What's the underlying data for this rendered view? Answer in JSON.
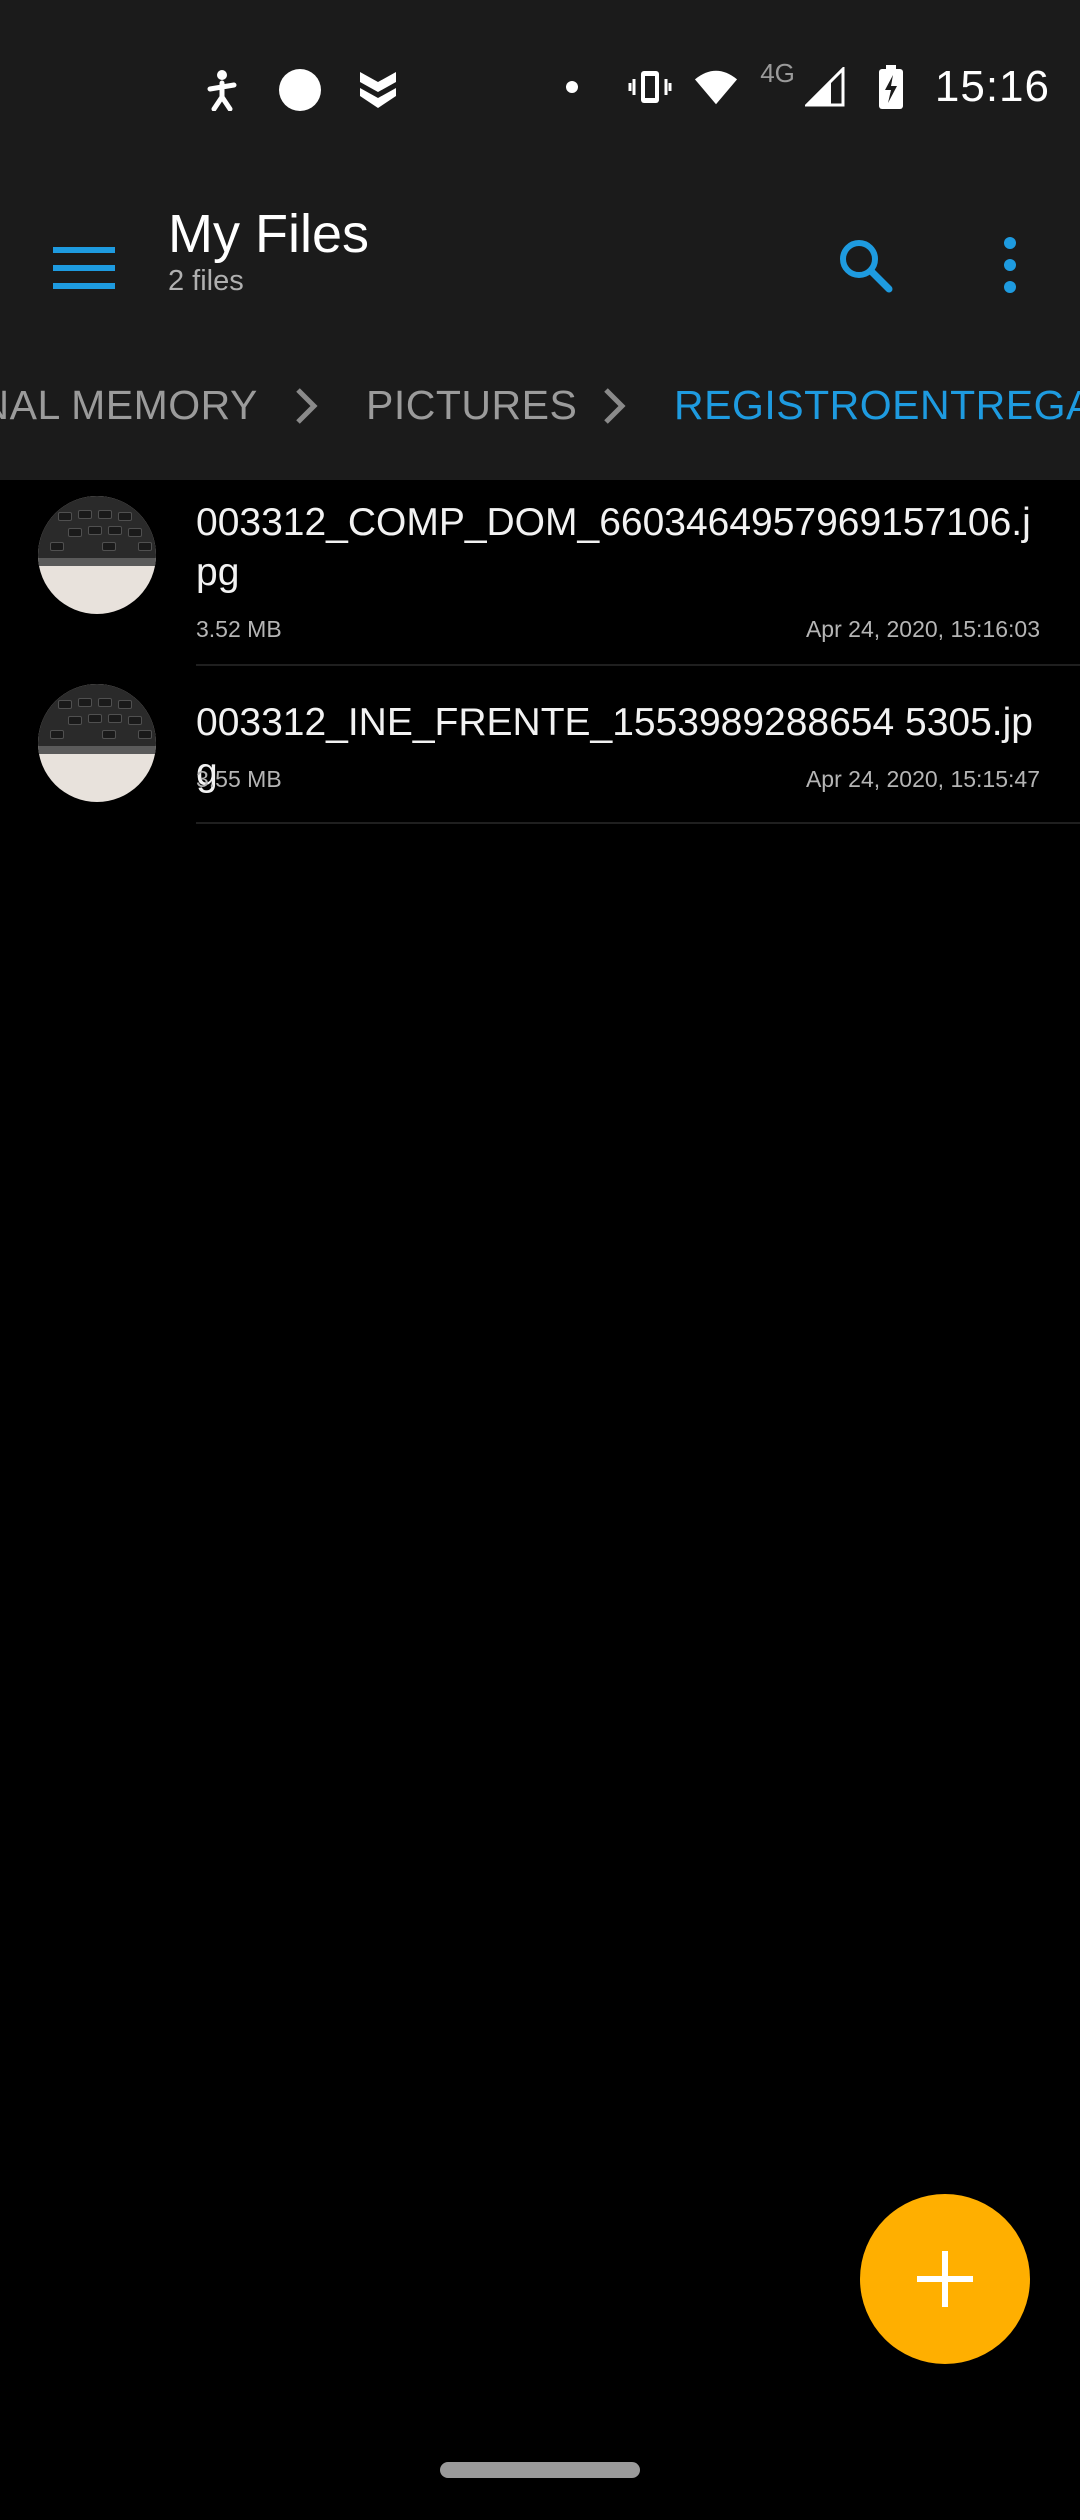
{
  "status_bar": {
    "time": "15:16",
    "network": "4G",
    "icons": [
      "accessibility-icon",
      "circle-icon",
      "shield-icon",
      "notification-dot",
      "vibrate-icon",
      "wifi-icon",
      "signal-icon",
      "battery-charging-icon"
    ]
  },
  "app_bar": {
    "title": "My Files",
    "subtitle": "2 files",
    "accent_color": "#1e9be0"
  },
  "breadcrumb": {
    "items": [
      {
        "label": "INTERNAL MEMORY",
        "active": false
      },
      {
        "label": "PICTURES",
        "active": false
      },
      {
        "label": "REGISTROENTREGA",
        "active": true
      }
    ]
  },
  "files": [
    {
      "name": "003312_COMP_DOM_6603464957969157106.jpg",
      "size": "3.52 MB",
      "date": "Apr 24, 2020, 15:16:03"
    },
    {
      "name": "003312_INE_FRENTE_1553989288654 5305.jpg",
      "size": "3.55 MB",
      "date": "Apr 24, 2020, 15:15:47"
    }
  ],
  "fab": {
    "icon": "plus-icon",
    "color": "#ffaf00"
  }
}
